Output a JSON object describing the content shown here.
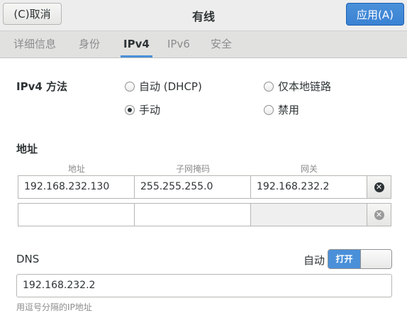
{
  "header": {
    "cancel_label": "(C)取消",
    "title": "有线",
    "apply_label": "应用(A)"
  },
  "tabs": [
    {
      "label": "详细信息",
      "active": false
    },
    {
      "label": "身份",
      "active": false
    },
    {
      "label": "IPv4",
      "active": true
    },
    {
      "label": "IPv6",
      "active": false
    },
    {
      "label": "安全",
      "active": false
    }
  ],
  "ipv4_method": {
    "label": "IPv4 方法",
    "options": [
      {
        "label": "自动 (DHCP)",
        "checked": false
      },
      {
        "label": "仅本地链路",
        "checked": false
      },
      {
        "label": "手动",
        "checked": true
      },
      {
        "label": "禁用",
        "checked": false
      }
    ]
  },
  "addresses": {
    "label": "地址",
    "columns": [
      "地址",
      "子网掩码",
      "网关"
    ],
    "rows": [
      {
        "address": "192.168.232.130",
        "netmask": "255.255.255.0",
        "gateway": "192.168.232.2"
      },
      {
        "address": "",
        "netmask": "",
        "gateway": ""
      }
    ]
  },
  "dns": {
    "label": "DNS",
    "auto_label": "自动",
    "switch_label": "打开",
    "switch_on": true,
    "value": "192.168.232.2",
    "hint": "用逗号分隔的IP地址"
  },
  "colors": {
    "accent": "#4a90d9",
    "header_bg": "#ededed",
    "tabs_bg": "#e1e1e0"
  }
}
